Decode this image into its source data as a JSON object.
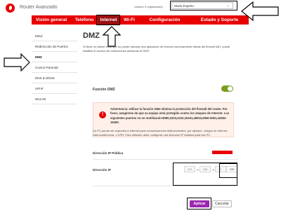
{
  "header": {
    "app_title": "Router Avanzado",
    "user_label": "Usuario 3 registrado(s)",
    "mode_select_value": "Modo Experto"
  },
  "nav": {
    "items": [
      {
        "label": "Visión general"
      },
      {
        "label": "Teléfono"
      },
      {
        "label": "Internet"
      },
      {
        "label": "Wi-Fi"
      },
      {
        "label": "Configuración"
      },
      {
        "label": "Estado y Soporte"
      }
    ],
    "active": "Internet"
  },
  "sidebar": {
    "items": [
      {
        "label": "Móvil"
      },
      {
        "label": "Redirección de Puertos"
      },
      {
        "label": "DMZ"
      },
      {
        "label": "Control Parental"
      },
      {
        "label": "DNS & DDNS"
      },
      {
        "label": "UPnP"
      },
      {
        "label": "WoLAN"
      }
    ],
    "active": "DMZ"
  },
  "main": {
    "title": "DMZ",
    "intro": "Si tiene un cliente local que no puede ejecutar una aplicación de Internet correctamente detrás del firewall NAT, puede habilitar el acceso sin restricciones activando el DMZ.",
    "dmz_toggle_label": "Función DMZ",
    "dmz_enabled": true,
    "warning": "Advertencia: Utilizar la función DMZ elimina la protección del firewall del router. Por favor, asegúrese de que su equipo está protegido contra los ataques de Internet. Los siguientes puertos no se reutilizarán:8080,2323,2222,16161,46910,5060-5061,16384-16400.",
    "description": "Un PC puede ser expuesto a Internet para comunicaciones bidireccionales; por ejemplo, Juegos en Internet, videoconferencia, o VPN. Para utilizarlo debe configurar una dirección IP estática para ese PC.",
    "public_ip_label": "Dirección IP Pública",
    "ip_label": "Dirección IP",
    "ip_octets": [
      "192",
      "168",
      "0",
      "100"
    ],
    "apply_label": "Aplicar",
    "cancel_label": "Cancelar"
  },
  "colors": {
    "brand_red": "#e60000",
    "nav_active": "#9b0e0e",
    "apply_button": "#9c27b0",
    "toggle_on": "#7b9b21"
  }
}
